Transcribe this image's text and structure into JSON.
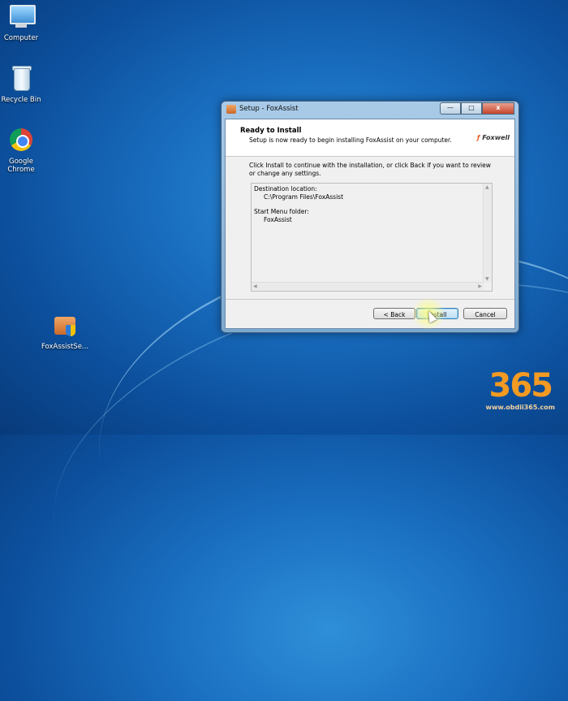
{
  "desktop": {
    "icons": [
      {
        "label": "Computer"
      },
      {
        "label": "Recycle Bin"
      },
      {
        "label": "Google Chrome"
      },
      {
        "label": "FoxAssistSe..."
      }
    ]
  },
  "window": {
    "title": "Setup - FoxAssist",
    "controls": {
      "minimize": "—",
      "maximize": "□",
      "close": "x"
    },
    "header": {
      "title": "Ready to Install",
      "subtitle": "Setup is now ready to begin installing FoxAssist on your computer.",
      "logo": "Foxwell"
    },
    "intro": "Click Install to continue with the installation, or click Back if you want to review or change any settings.",
    "memo": {
      "dest_label": "Destination location:",
      "dest_value": "C:\\Program Files\\FoxAssist",
      "start_label": "Start Menu folder:",
      "start_value": "FoxAssist"
    },
    "buttons": {
      "back": "< Back",
      "install": "Install",
      "cancel": "Cancel"
    }
  },
  "watermark": {
    "number": "365",
    "url": "www.obdii365.com"
  },
  "colors": {
    "accent_orange": "#f29a22",
    "logo_orange": "#e25b1c"
  }
}
